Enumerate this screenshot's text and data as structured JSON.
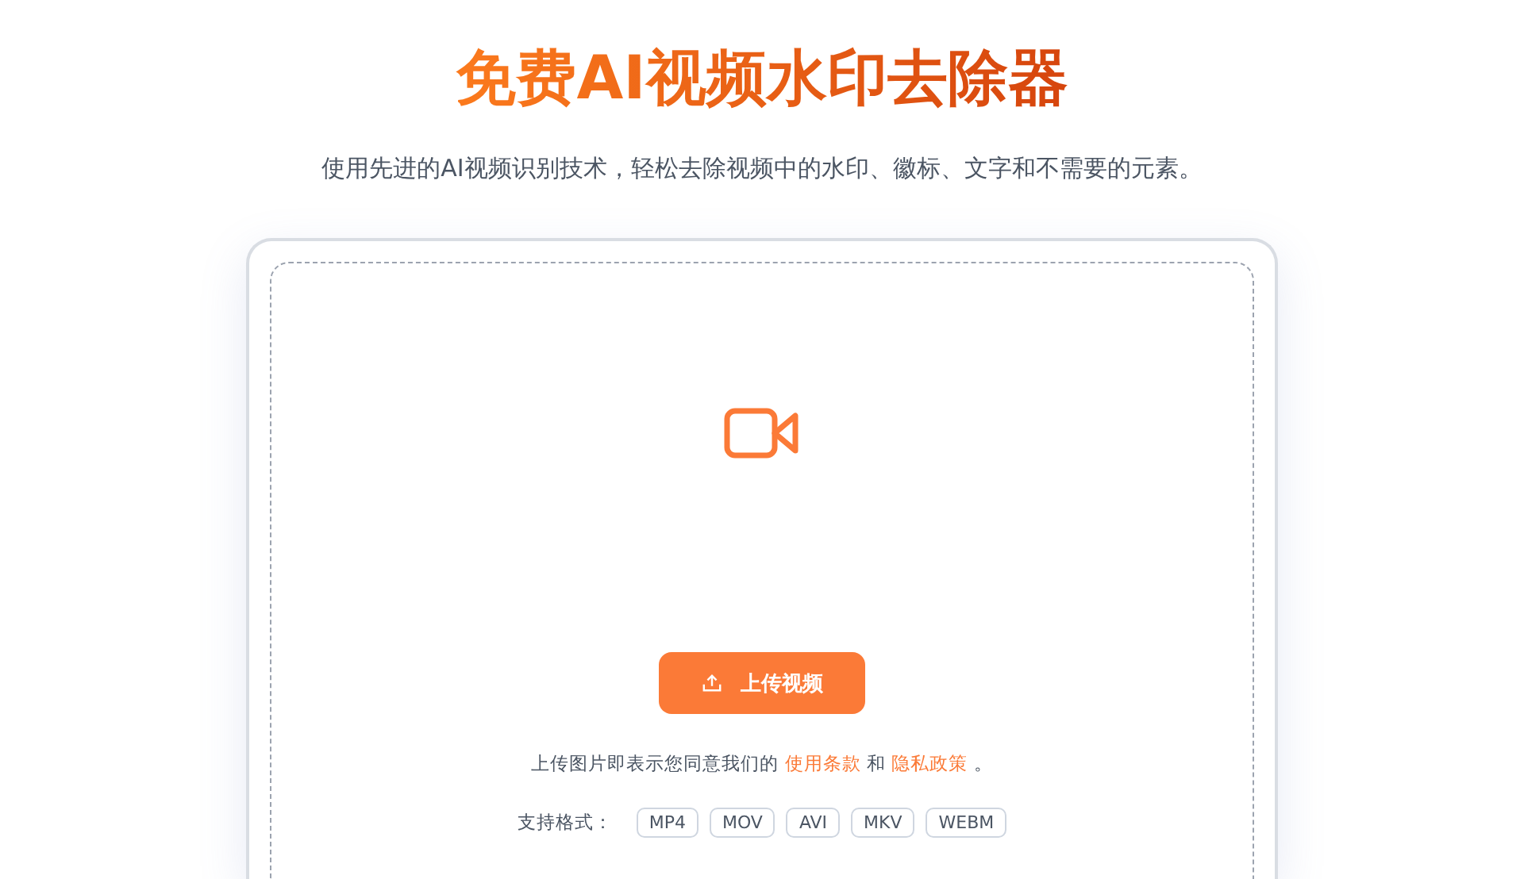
{
  "title": "免费AI视频水印去除器",
  "subtitle": "使用先进的AI视频识别技术，轻松去除视频中的水印、徽标、文字和不需要的元素。",
  "upload": {
    "button": "上传视频",
    "consent": {
      "before": "上传图片即表示您同意我们的",
      "terms": "使用条款",
      "middle": "和",
      "privacy": "隐私政策",
      "after": "。"
    },
    "formats_label": "支持格式：",
    "formats": [
      "MP4",
      "MOV",
      "AVI",
      "MKV",
      "WEBM"
    ]
  }
}
